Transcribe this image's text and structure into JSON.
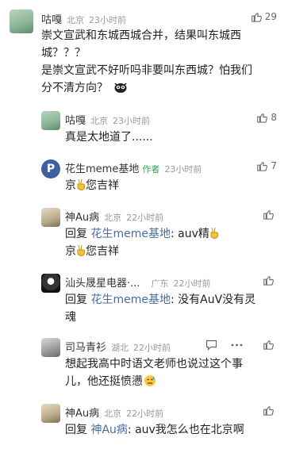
{
  "comments": [
    {
      "name": "咕嘎",
      "location": "北京",
      "time": "23小时前",
      "likes": "29",
      "lines": [
        "崇文宣武和东城西城合并，结果叫东城西",
        "城？？？",
        "是崇文宣武不好听吗非要叫东西城？怕我们",
        "分不清方向？"
      ],
      "emoji": "owl-emoji"
    },
    {
      "name": "咕嘎",
      "location": "北京",
      "time": "23小时前",
      "likes": "8",
      "text": "真是太地道了......"
    },
    {
      "name": "花生meme基地",
      "author_tag": "作者",
      "time": "23小时前",
      "likes": "7",
      "avatar_letter": "P",
      "text_prefix": "京",
      "text_suffix": "您吉祥"
    },
    {
      "name": "神Au病",
      "location": "北京",
      "time": "22小时前",
      "reply_prefix": "回复",
      "reply_to": "花生meme基地",
      "reply_text": ": auv精",
      "line2_prefix": "京",
      "line2_suffix": "您吉祥"
    },
    {
      "name": "汕头晟星电器·...",
      "location": "广东",
      "time": "22小时前",
      "reply_prefix": "回复",
      "reply_to": "花生meme基地",
      "reply_text": ": 没有AuV没有灵",
      "line2": "魂"
    },
    {
      "name": "司马青衫",
      "location": "湖北",
      "time": "22小时前",
      "lines": [
        "想起我高中时语文老师也说过这个事",
        "儿，他还挺愤懑"
      ]
    },
    {
      "name": "神Au病",
      "location": "北京",
      "time": "22小时前",
      "reply_prefix": "回复",
      "reply_to": "神Au病",
      "reply_text": ": auv我怎么也在北京啊"
    }
  ]
}
